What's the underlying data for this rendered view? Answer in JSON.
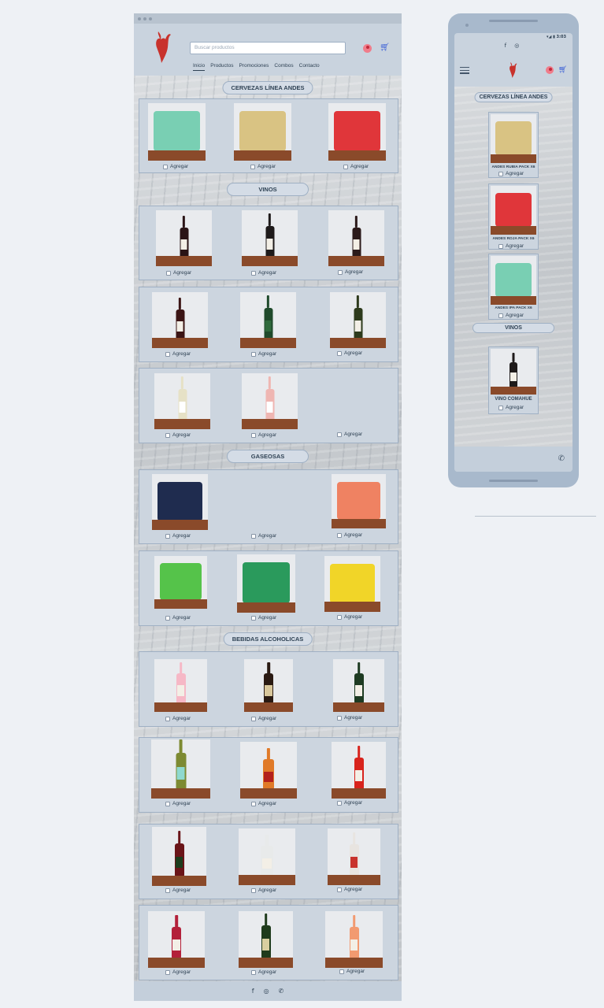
{
  "desktop": {
    "search_placeholder": "Buscar productos",
    "nav": [
      "Inicio",
      "Productos",
      "Promociones",
      "Combos",
      "Contacto"
    ],
    "add_label": "Agregar",
    "sections": {
      "cervezas": "CERVEZAS LÍNEA ANDES",
      "vinos": "VINOS",
      "gaseosas": "GASEOSAS",
      "bebidas": "BEBIDAS ALCOHOLICAS"
    },
    "footer_icons": [
      "f",
      "◎",
      "✆"
    ]
  },
  "phone": {
    "status": "▾◢ ▮ 3:03",
    "social": "f ◎",
    "sections": {
      "cervezas": "CERVEZAS LÍNEA ANDES",
      "vinos": "VINOS"
    },
    "products": [
      {
        "name": "ANDES RUBIA PACK X6",
        "add": "Agregar"
      },
      {
        "name": "ANDES ROJA PACK X6",
        "add": "Agregar"
      },
      {
        "name": "ANDES IPA PACK X6",
        "add": "Agregar"
      },
      {
        "name": "VINO COMAHUE",
        "add": "Agregar"
      }
    ],
    "whatsapp": "✆"
  },
  "colors": {
    "accent_red": "#c8322c",
    "cart_blue": "#3a5fd6",
    "panel": "#ccd5df"
  }
}
